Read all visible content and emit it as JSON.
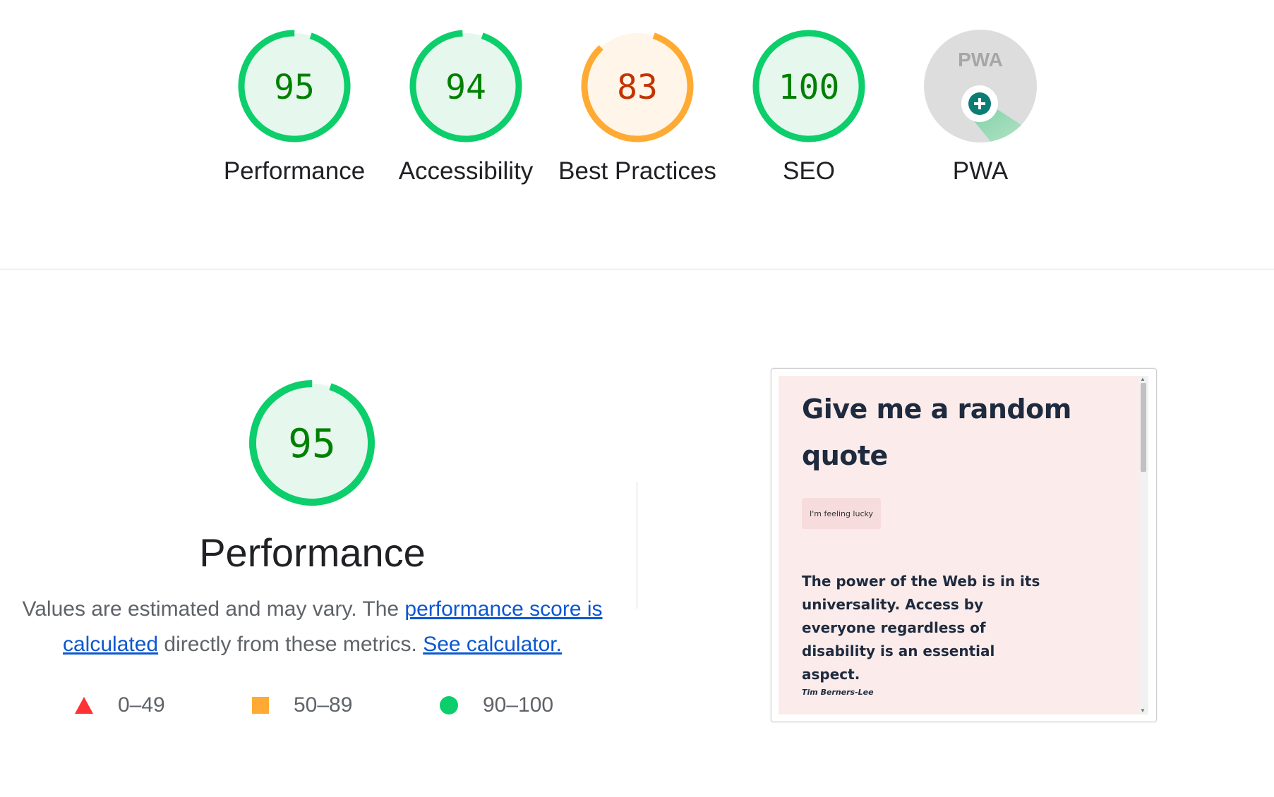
{
  "categories": [
    {
      "label": "Performance",
      "score": 95,
      "rating": "pass"
    },
    {
      "label": "Accessibility",
      "score": 94,
      "rating": "pass"
    },
    {
      "label": "Best Practices",
      "score": 83,
      "rating": "average"
    },
    {
      "label": "SEO",
      "score": 100,
      "rating": "pass"
    },
    {
      "label": "PWA",
      "badge": "PWA",
      "rating": "pwa"
    }
  ],
  "colors": {
    "pass_ring": "#0cce6b",
    "pass_fill": "#e6f7ee",
    "pass_text": "#008000",
    "average_ring": "#ffaa33",
    "average_fill": "#fff5e8",
    "average_text": "#c33300",
    "fail": "#ff3333",
    "pwa_bg": "#dddddd",
    "pwa_accent": "#0b7d75",
    "link": "#0b57d0"
  },
  "performance": {
    "score": 95,
    "title": "Performance",
    "description": {
      "text_1": "Values are estimated and may vary. The ",
      "link_1": "performance score is calculated",
      "text_2": " directly from these metrics. ",
      "link_2": "See calculator."
    },
    "legend": [
      {
        "shape": "triangle-icon",
        "range": "0–49"
      },
      {
        "shape": "square-icon",
        "range": "50–89"
      },
      {
        "shape": "circle-icon",
        "range": "90–100"
      }
    ]
  },
  "screenshot": {
    "heading": "Give me a random quote",
    "button_label": "I'm feeling lucky",
    "quote": "The power of the Web is in its universality. Access by everyone regardless of disability is an essential aspect.",
    "author": "Tim Berners-Lee"
  }
}
